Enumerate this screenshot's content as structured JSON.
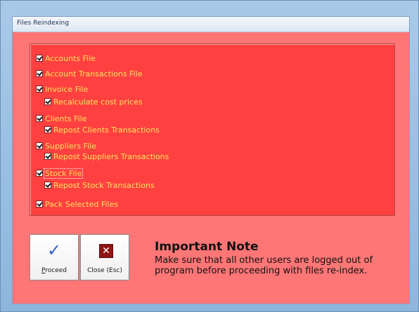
{
  "window": {
    "title": "Files Reindexing"
  },
  "options": {
    "accounts_file": "Accounts File",
    "account_transactions_file": "Account Transactions File",
    "invoice_file": "Invoice File",
    "recalculate_cost_prices": "Recalculate cost prices",
    "clients_file": "Clients File",
    "repost_clients_transactions": "Repost Clients Transactions",
    "suppliers_file": "Suppliers File",
    "repost_suppliers_transactions": "Repost Suppliers Transactions",
    "stock_file": "Stock File",
    "repost_stock_transactions": "Repost Stock Transactions",
    "pack_selected_files": "Pack Selected Files"
  },
  "buttons": {
    "proceed_prefix": "P",
    "proceed_rest": "roceed",
    "close": "Close (Esc)",
    "close_glyph": "✕",
    "proceed_glyph": "✓"
  },
  "note": {
    "title": "Important Note",
    "text": "Make sure that all other users are logged out of program before proceeding with files re-index."
  },
  "colors": {
    "panel": "#ff4040",
    "background": "#ff7676",
    "label": "#ffe35a",
    "close_icon": "#8f1515",
    "proceed_icon": "#2f5fd0"
  },
  "icons": {
    "proceed": "checkmark-icon",
    "close": "close-x-icon"
  }
}
